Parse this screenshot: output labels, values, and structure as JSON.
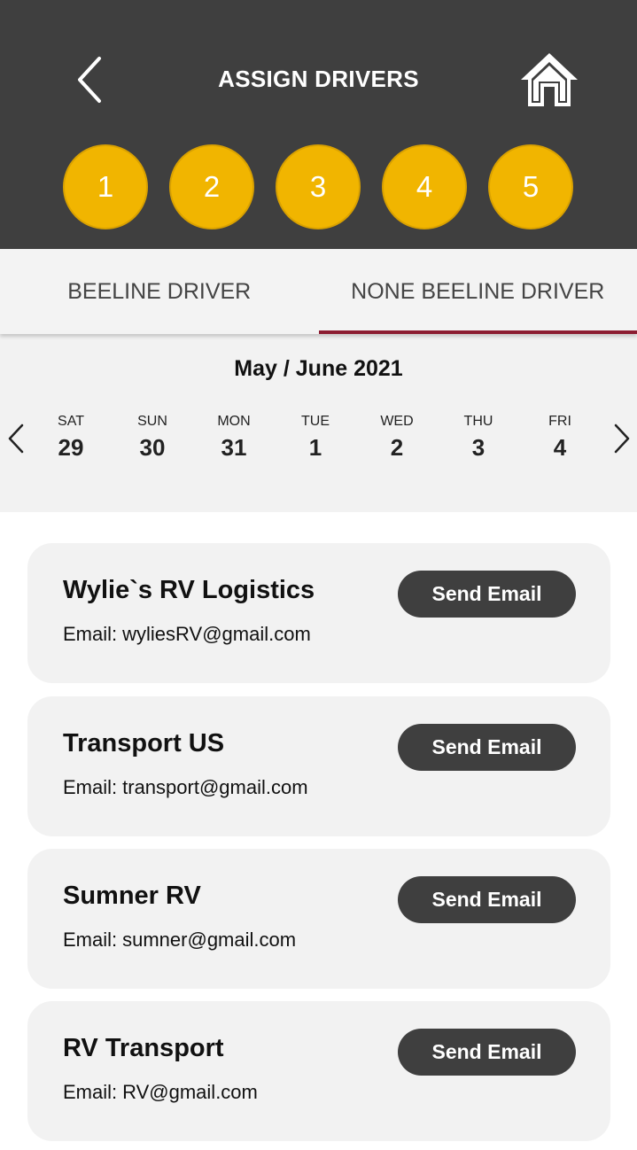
{
  "header": {
    "title": "ASSIGN DRIVERS",
    "back_icon": "chevron-left-icon",
    "home_icon": "home-icon",
    "background": "#3f3f3f"
  },
  "steps": [
    "1",
    "2",
    "3",
    "4",
    "5"
  ],
  "step_color": "#f1b500",
  "tabs": [
    {
      "label": "BEELINE DRIVER",
      "active": false
    },
    {
      "label": "NONE BEELINE DRIVER",
      "active": true
    }
  ],
  "tab_indicator_color": "#8c1c31",
  "calendar": {
    "month_label": "May / June 2021",
    "days": [
      {
        "name": "SAT",
        "num": "29"
      },
      {
        "name": "SUN",
        "num": "30"
      },
      {
        "name": "MON",
        "num": "31"
      },
      {
        "name": "TUE",
        "num": "1"
      },
      {
        "name": "WED",
        "num": "2"
      },
      {
        "name": "THU",
        "num": "3"
      },
      {
        "name": "FRI",
        "num": "4"
      }
    ]
  },
  "email_prefix": "Email:",
  "drivers": [
    {
      "name": "Wylie`s RV Logistics",
      "email": "wyliesRV@gmail.com",
      "button": "Send Email"
    },
    {
      "name": "Transport US",
      "email": "transport@gmail.com",
      "button": "Send Email"
    },
    {
      "name": "Sumner RV",
      "email": "sumner@gmail.com",
      "button": "Send Email"
    },
    {
      "name": "RV Transport",
      "email": "RV@gmail.com",
      "button": "Send Email"
    }
  ]
}
